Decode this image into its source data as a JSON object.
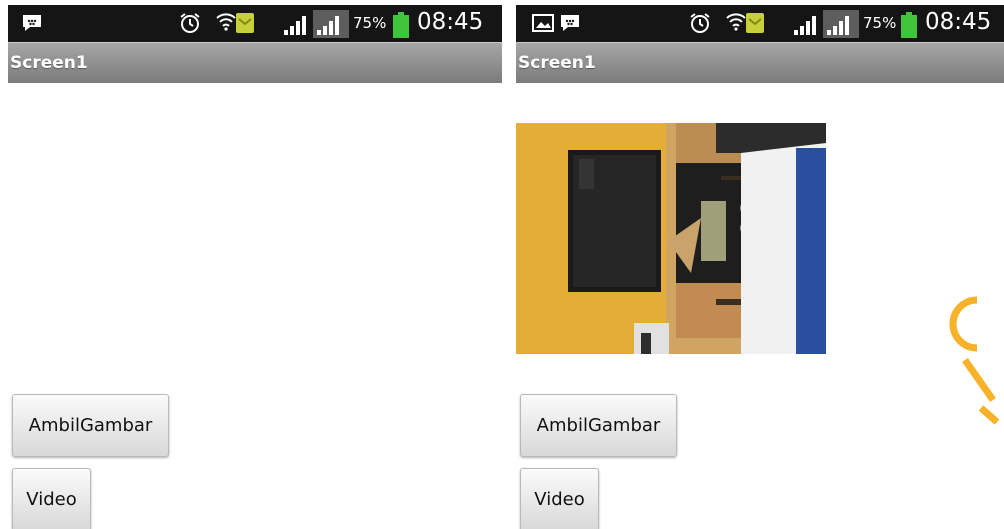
{
  "screens": [
    {
      "title": "Screen1",
      "status": {
        "battery": "75%",
        "time": "08:45"
      },
      "buttons": {
        "ambil": "AmbilGambar",
        "video": "Video"
      },
      "has_image": false
    },
    {
      "title": "Screen1",
      "status": {
        "battery": "75%",
        "time": "08:45"
      },
      "buttons": {
        "ambil": "AmbilGambar",
        "video": "Video"
      },
      "has_image": true
    }
  ],
  "colors": {
    "status_bar": "#151515",
    "title_bar": "#8c8c8c",
    "battery_green": "#3fc43a",
    "wall_yellow": "#e7b43c",
    "watermark": "#f7b22a"
  },
  "icons": [
    "bbm-chat-icon",
    "alarm-icon",
    "wifi-icon",
    "sim-card-icon",
    "signal-icon",
    "battery-icon",
    "picture-icon"
  ]
}
